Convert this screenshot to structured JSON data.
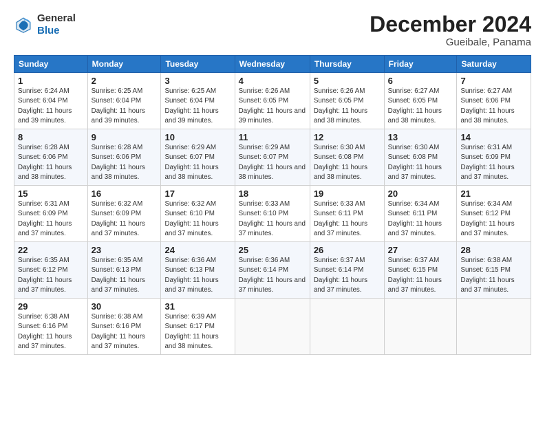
{
  "logo": {
    "line1": "General",
    "line2": "Blue"
  },
  "title": "December 2024",
  "subtitle": "Gueibale, Panama",
  "header": {
    "days": [
      "Sunday",
      "Monday",
      "Tuesday",
      "Wednesday",
      "Thursday",
      "Friday",
      "Saturday"
    ]
  },
  "weeks": [
    [
      {
        "day": "1",
        "sunrise": "6:24 AM",
        "sunset": "6:04 PM",
        "daylight": "11 hours and 39 minutes."
      },
      {
        "day": "2",
        "sunrise": "6:25 AM",
        "sunset": "6:04 PM",
        "daylight": "11 hours and 39 minutes."
      },
      {
        "day": "3",
        "sunrise": "6:25 AM",
        "sunset": "6:04 PM",
        "daylight": "11 hours and 39 minutes."
      },
      {
        "day": "4",
        "sunrise": "6:26 AM",
        "sunset": "6:05 PM",
        "daylight": "11 hours and 39 minutes."
      },
      {
        "day": "5",
        "sunrise": "6:26 AM",
        "sunset": "6:05 PM",
        "daylight": "11 hours and 38 minutes."
      },
      {
        "day": "6",
        "sunrise": "6:27 AM",
        "sunset": "6:05 PM",
        "daylight": "11 hours and 38 minutes."
      },
      {
        "day": "7",
        "sunrise": "6:27 AM",
        "sunset": "6:06 PM",
        "daylight": "11 hours and 38 minutes."
      }
    ],
    [
      {
        "day": "8",
        "sunrise": "6:28 AM",
        "sunset": "6:06 PM",
        "daylight": "11 hours and 38 minutes."
      },
      {
        "day": "9",
        "sunrise": "6:28 AM",
        "sunset": "6:06 PM",
        "daylight": "11 hours and 38 minutes."
      },
      {
        "day": "10",
        "sunrise": "6:29 AM",
        "sunset": "6:07 PM",
        "daylight": "11 hours and 38 minutes."
      },
      {
        "day": "11",
        "sunrise": "6:29 AM",
        "sunset": "6:07 PM",
        "daylight": "11 hours and 38 minutes."
      },
      {
        "day": "12",
        "sunrise": "6:30 AM",
        "sunset": "6:08 PM",
        "daylight": "11 hours and 38 minutes."
      },
      {
        "day": "13",
        "sunrise": "6:30 AM",
        "sunset": "6:08 PM",
        "daylight": "11 hours and 37 minutes."
      },
      {
        "day": "14",
        "sunrise": "6:31 AM",
        "sunset": "6:09 PM",
        "daylight": "11 hours and 37 minutes."
      }
    ],
    [
      {
        "day": "15",
        "sunrise": "6:31 AM",
        "sunset": "6:09 PM",
        "daylight": "11 hours and 37 minutes."
      },
      {
        "day": "16",
        "sunrise": "6:32 AM",
        "sunset": "6:09 PM",
        "daylight": "11 hours and 37 minutes."
      },
      {
        "day": "17",
        "sunrise": "6:32 AM",
        "sunset": "6:10 PM",
        "daylight": "11 hours and 37 minutes."
      },
      {
        "day": "18",
        "sunrise": "6:33 AM",
        "sunset": "6:10 PM",
        "daylight": "11 hours and 37 minutes."
      },
      {
        "day": "19",
        "sunrise": "6:33 AM",
        "sunset": "6:11 PM",
        "daylight": "11 hours and 37 minutes."
      },
      {
        "day": "20",
        "sunrise": "6:34 AM",
        "sunset": "6:11 PM",
        "daylight": "11 hours and 37 minutes."
      },
      {
        "day": "21",
        "sunrise": "6:34 AM",
        "sunset": "6:12 PM",
        "daylight": "11 hours and 37 minutes."
      }
    ],
    [
      {
        "day": "22",
        "sunrise": "6:35 AM",
        "sunset": "6:12 PM",
        "daylight": "11 hours and 37 minutes."
      },
      {
        "day": "23",
        "sunrise": "6:35 AM",
        "sunset": "6:13 PM",
        "daylight": "11 hours and 37 minutes."
      },
      {
        "day": "24",
        "sunrise": "6:36 AM",
        "sunset": "6:13 PM",
        "daylight": "11 hours and 37 minutes."
      },
      {
        "day": "25",
        "sunrise": "6:36 AM",
        "sunset": "6:14 PM",
        "daylight": "11 hours and 37 minutes."
      },
      {
        "day": "26",
        "sunrise": "6:37 AM",
        "sunset": "6:14 PM",
        "daylight": "11 hours and 37 minutes."
      },
      {
        "day": "27",
        "sunrise": "6:37 AM",
        "sunset": "6:15 PM",
        "daylight": "11 hours and 37 minutes."
      },
      {
        "day": "28",
        "sunrise": "6:38 AM",
        "sunset": "6:15 PM",
        "daylight": "11 hours and 37 minutes."
      }
    ],
    [
      {
        "day": "29",
        "sunrise": "6:38 AM",
        "sunset": "6:16 PM",
        "daylight": "11 hours and 37 minutes."
      },
      {
        "day": "30",
        "sunrise": "6:38 AM",
        "sunset": "6:16 PM",
        "daylight": "11 hours and 37 minutes."
      },
      {
        "day": "31",
        "sunrise": "6:39 AM",
        "sunset": "6:17 PM",
        "daylight": "11 hours and 38 minutes."
      },
      null,
      null,
      null,
      null
    ]
  ]
}
